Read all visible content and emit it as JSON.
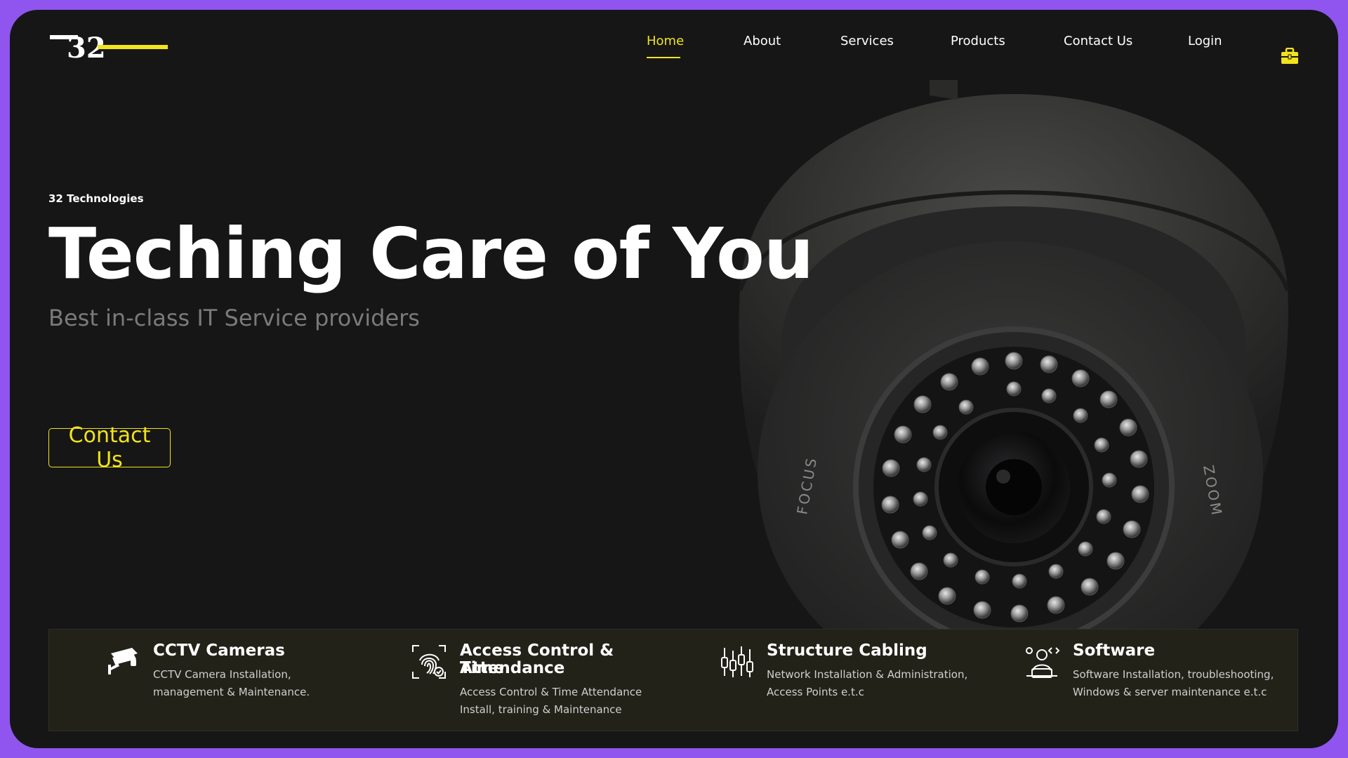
{
  "brand": {
    "logo_text": "32",
    "accent": "#f1e31c",
    "frame_color": "#8f55ee",
    "background": "#161617"
  },
  "nav": {
    "items": [
      {
        "label": "Home",
        "active": true
      },
      {
        "label": "About"
      },
      {
        "label": "Services"
      },
      {
        "label": "Products"
      },
      {
        "label": "Contact Us"
      },
      {
        "label": "Login"
      }
    ],
    "cart_icon": "briefcase-icon"
  },
  "hero": {
    "kicker": "32 Technologies",
    "headline": "Teching Care of You",
    "subheadline": "Best in-class IT Service providers",
    "cta_label": "Contact Us",
    "image": "dome-security-camera",
    "camera_labels": {
      "left": "FOCUS",
      "right": "ZOOM"
    }
  },
  "services": [
    {
      "icon": "cctv-camera-icon",
      "title": "CCTV Cameras",
      "desc_lines": [
        "CCTV Camera Installation,",
        "management & Maintenance."
      ]
    },
    {
      "icon": "fingerprint-scan-icon",
      "title_lines": [
        "Access Control & Time",
        "Attendance"
      ],
      "desc_lines": [
        "Access Control & Time Attendance",
        "Install, training & Maintenance"
      ]
    },
    {
      "icon": "network-cabling-icon",
      "title": "Structure Cabling",
      "desc_lines": [
        "Network Installation & Administration,",
        "Access Points e.t.c"
      ]
    },
    {
      "icon": "software-developer-icon",
      "title": "Software",
      "desc_lines": [
        "Software Installation, troubleshooting,",
        "Windows & server maintenance e.t.c"
      ]
    }
  ]
}
